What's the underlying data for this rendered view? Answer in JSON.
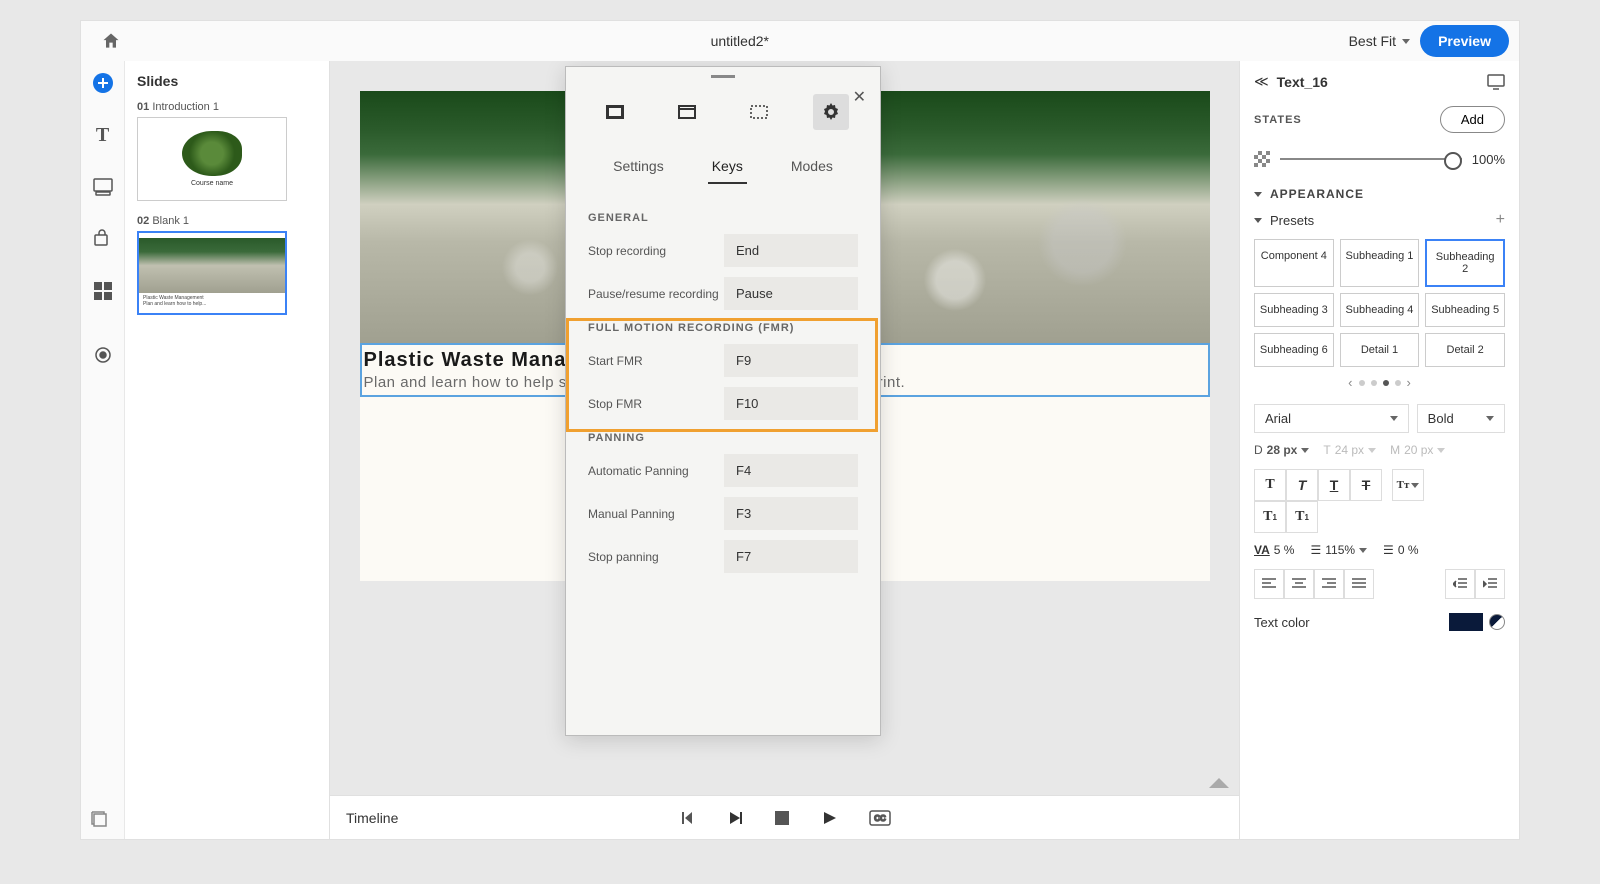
{
  "titlebar": {
    "title": "untitled2*",
    "zoom": "Best Fit",
    "preview": "Preview"
  },
  "slides": {
    "title": "Slides",
    "items": [
      {
        "num": "01",
        "name": "Introduction 1",
        "caption": "Course name"
      },
      {
        "num": "02",
        "name": "Blank 1",
        "caption": ""
      }
    ]
  },
  "canvas": {
    "heading": "Plastic Waste Management",
    "body": "Plan and learn how to help save our planet by reducing the carbon footprint."
  },
  "timeline": {
    "label": "Timeline"
  },
  "modal": {
    "tabs": [
      "Settings",
      "Keys",
      "Modes"
    ],
    "groups": [
      {
        "title": "GENERAL",
        "rows": [
          {
            "label": "Stop recording",
            "value": "End"
          },
          {
            "label": "Pause/resume recording",
            "value": "Pause"
          }
        ]
      },
      {
        "title": "FULL MOTION RECORDING (FMR)",
        "highlight": true,
        "rows": [
          {
            "label": "Start FMR",
            "value": "F9"
          },
          {
            "label": "Stop FMR",
            "value": "F10"
          }
        ]
      },
      {
        "title": "PANNING",
        "rows": [
          {
            "label": "Automatic Panning",
            "value": "F4"
          },
          {
            "label": "Manual Panning",
            "value": "F3"
          },
          {
            "label": "Stop panning",
            "value": "F7"
          }
        ]
      }
    ]
  },
  "props": {
    "object": "Text_16",
    "states_label": "STATES",
    "add": "Add",
    "opacity": "100%",
    "appearance": "APPEARANCE",
    "presets_label": "Presets",
    "presets": [
      "Component 4",
      "Subheading 1",
      "Subheading 2",
      "Subheading 3",
      "Subheading 4",
      "Subheading 5",
      "Subheading 6",
      "Detail 1",
      "Detail 2"
    ],
    "preset_selected": 2,
    "font_family": "Arial",
    "font_weight": "Bold",
    "size_d": "28 px",
    "size_t": "24 px",
    "size_m": "20 px",
    "letter_spacing": "5 %",
    "line_height": "115%",
    "para_spacing": "0 %",
    "text_color_label": "Text color",
    "text_color": "#0a1a3a"
  }
}
